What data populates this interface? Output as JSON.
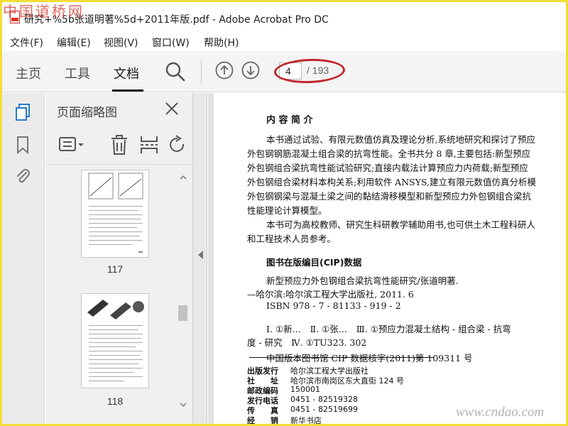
{
  "watermarks": {
    "top_left": "中国道桥网",
    "bottom_right": "www.cndao.com"
  },
  "window": {
    "title": "研究+%5b张道明著%5d+2011年版.pdf - Adobe Acrobat Pro DC",
    "file_icon": "pdf-file-icon"
  },
  "menu": {
    "items": [
      "文件(F)",
      "编辑(E)",
      "视图(V)",
      "窗口(W)",
      "帮助(H)"
    ]
  },
  "toolbar": {
    "tabs": [
      "主页",
      "工具",
      "文档"
    ],
    "active_tab": "文档",
    "search_icon": "search-icon",
    "prev_icon": "page-up-icon",
    "next_icon": "page-down-icon",
    "page_current": "4",
    "page_total": "/ 193",
    "highlight_color": "#c1272d"
  },
  "left_strip": {
    "icons": [
      "page-thumbnails-icon",
      "bookmark-icon",
      "attachment-icon"
    ]
  },
  "thumb_panel": {
    "title": "页面缩略图",
    "toolbar_icons": [
      "options-menu-icon",
      "delete-icon",
      "insert-page-icon",
      "rotate-icon"
    ],
    "thumbnails": [
      {
        "label": "117"
      },
      {
        "label": "118"
      }
    ]
  },
  "document": {
    "heading": "内 容 简 介",
    "paragraph_lines": [
      "本书通过试验、有限元数值仿真及理论分析,系统地研究和探讨了预应",
      "外包钢钢筋混凝土组合梁的抗弯性能。全书共分 8 章,主要包括:新型预应",
      "外包钢组合梁抗弯性能试验研究;直接内载法计算预应力内荷载;新型预应",
      "外包钢组合梁材料本构关系;利用软件 ANSYS,建立有限元数值仿真分析模",
      "外包钢钢梁与混凝土梁之间的黏结滑移模型和新型预应力外包钢组合梁抗",
      "性能理论计算模型。",
      "本书可为高校教师、研究生科研教学辅助用书,也可供土木工程科研人",
      "和工程技术人员参考。"
    ],
    "cip_heading": "图书在版编目(CIP)数据",
    "cip_lines": [
      "新型预应力外包钢组合梁抗弯性能研究/张道明著.",
      "—哈尔滨:哈尔滨工程大学出版社, 2011. 6",
      "ISBN 978 - 7 - 81133 - 919 - 2",
      "Ⅰ. ①新…　Ⅱ. ①张…　Ⅲ. ①预应力混凝土结构 - 组合梁 - 抗弯",
      "度 - 研究　Ⅳ. ①TU323. 302",
      "中国版本图书馆 CIP 数据核字(2011)第 109311 号"
    ],
    "publisher_rows": [
      {
        "key": "出版发行",
        "value": "哈尔滨工程大学出版社"
      },
      {
        "key": "社　　址",
        "value": "哈尔滨市南岗区东大直街 124 号"
      },
      {
        "key": "邮政编码",
        "value": "150001"
      },
      {
        "key": "发行电话",
        "value": "0451 - 82519328"
      },
      {
        "key": "传　　真",
        "value": "0451 - 82519699"
      },
      {
        "key": "经　　销",
        "value": "新华书店"
      }
    ]
  }
}
